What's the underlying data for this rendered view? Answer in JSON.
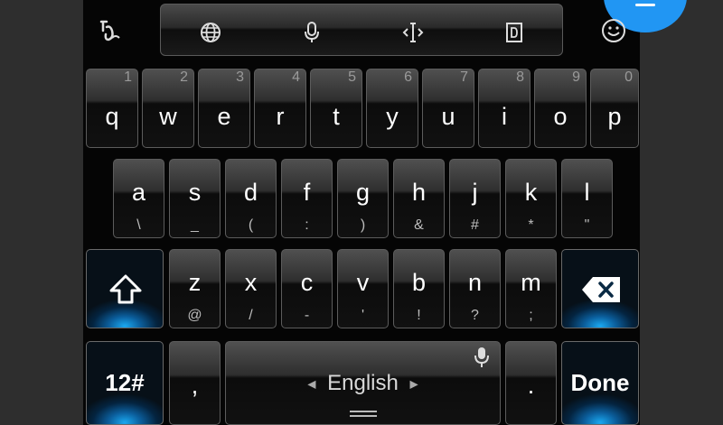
{
  "keyboard": {
    "toolbar": {
      "icons": [
        "handwriting-icon",
        "globe-icon",
        "microphone-icon",
        "cursor-icon",
        "clipboard-icon",
        "emoji-icon"
      ]
    },
    "row1": [
      {
        "main": "q",
        "num": "1"
      },
      {
        "main": "w",
        "num": "2"
      },
      {
        "main": "e",
        "num": "3"
      },
      {
        "main": "r",
        "num": "4"
      },
      {
        "main": "t",
        "num": "5"
      },
      {
        "main": "y",
        "num": "6"
      },
      {
        "main": "u",
        "num": "7"
      },
      {
        "main": "i",
        "num": "8"
      },
      {
        "main": "o",
        "num": "9"
      },
      {
        "main": "p",
        "num": "0"
      }
    ],
    "row2": [
      {
        "main": "a",
        "sub": "\\"
      },
      {
        "main": "s",
        "sub": "_"
      },
      {
        "main": "d",
        "sub": "("
      },
      {
        "main": "f",
        "sub": ":"
      },
      {
        "main": "g",
        "sub": ")"
      },
      {
        "main": "h",
        "sub": "&"
      },
      {
        "main": "j",
        "sub": "#"
      },
      {
        "main": "k",
        "sub": "*"
      },
      {
        "main": "l",
        "sub": "\""
      }
    ],
    "row3": [
      {
        "main": "z",
        "sub": "@"
      },
      {
        "main": "x",
        "sub": "/"
      },
      {
        "main": "c",
        "sub": "-"
      },
      {
        "main": "v",
        "sub": "'"
      },
      {
        "main": "b",
        "sub": "!"
      },
      {
        "main": "n",
        "sub": "?"
      },
      {
        "main": "m",
        "sub": ";"
      }
    ],
    "bottom": {
      "symbols_label": "12#",
      "comma": ",",
      "space_label": "English",
      "period": ".",
      "done_label": "Done"
    },
    "accent_color": "#1aa8f0",
    "fab_color": "#2196f3"
  }
}
